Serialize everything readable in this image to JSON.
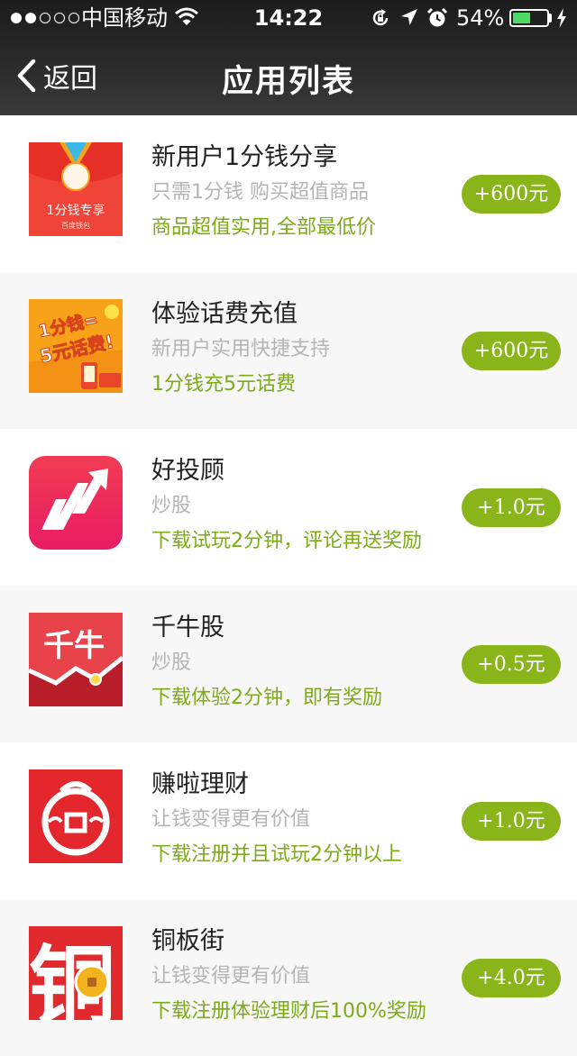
{
  "status_bar": {
    "carrier": "中国移动",
    "time": "14:22",
    "battery_percent": "54%",
    "battery_level": 0.54,
    "signal_bars": 2
  },
  "nav": {
    "back_label": "返回",
    "title": "应用列表"
  },
  "colors": {
    "accent": "#8ab51a",
    "promo_text": "#7cab17",
    "secondary_text": "#b4b4b4"
  },
  "apps": [
    {
      "name": "新用户1分钱分享",
      "desc": "只需1分钱 购买超值商品",
      "promo": "商品超值实用,全部最低价",
      "reward": "+600元",
      "icon": "red-envelope-icon",
      "icon_text": [
        "1分钱专享",
        "百度钱包"
      ]
    },
    {
      "name": "体验话费充值",
      "desc": "新用户实用快捷支持",
      "promo": "1分钱充5元话费",
      "reward": "+600元",
      "icon": "phone-credit-icon",
      "icon_text": [
        "1分钱=",
        "5元话费!"
      ]
    },
    {
      "name": "好投顾",
      "desc": "炒股",
      "promo": "下载试玩2分钟，评论再送奖励",
      "reward": "+1.0元",
      "icon": "rising-arrow-icon"
    },
    {
      "name": "千牛股",
      "desc": "炒股",
      "promo": "下载体验2分钟，即有奖励",
      "reward": "+0.5元",
      "icon": "qianniu-stock-icon",
      "icon_text": [
        "千牛"
      ]
    },
    {
      "name": "赚啦理财",
      "desc": "让钱变得更有价值",
      "promo": "下载注册并且试玩2分钟以上",
      "reward": "+1.0元",
      "icon": "zhuanla-face-icon"
    },
    {
      "name": "铜板街",
      "desc": "让钱变得更有价值",
      "promo": "下载注册体验理财后100%奖励",
      "reward": "+4.0元",
      "icon": "copper-coin-icon",
      "icon_text": [
        "铜"
      ]
    }
  ]
}
